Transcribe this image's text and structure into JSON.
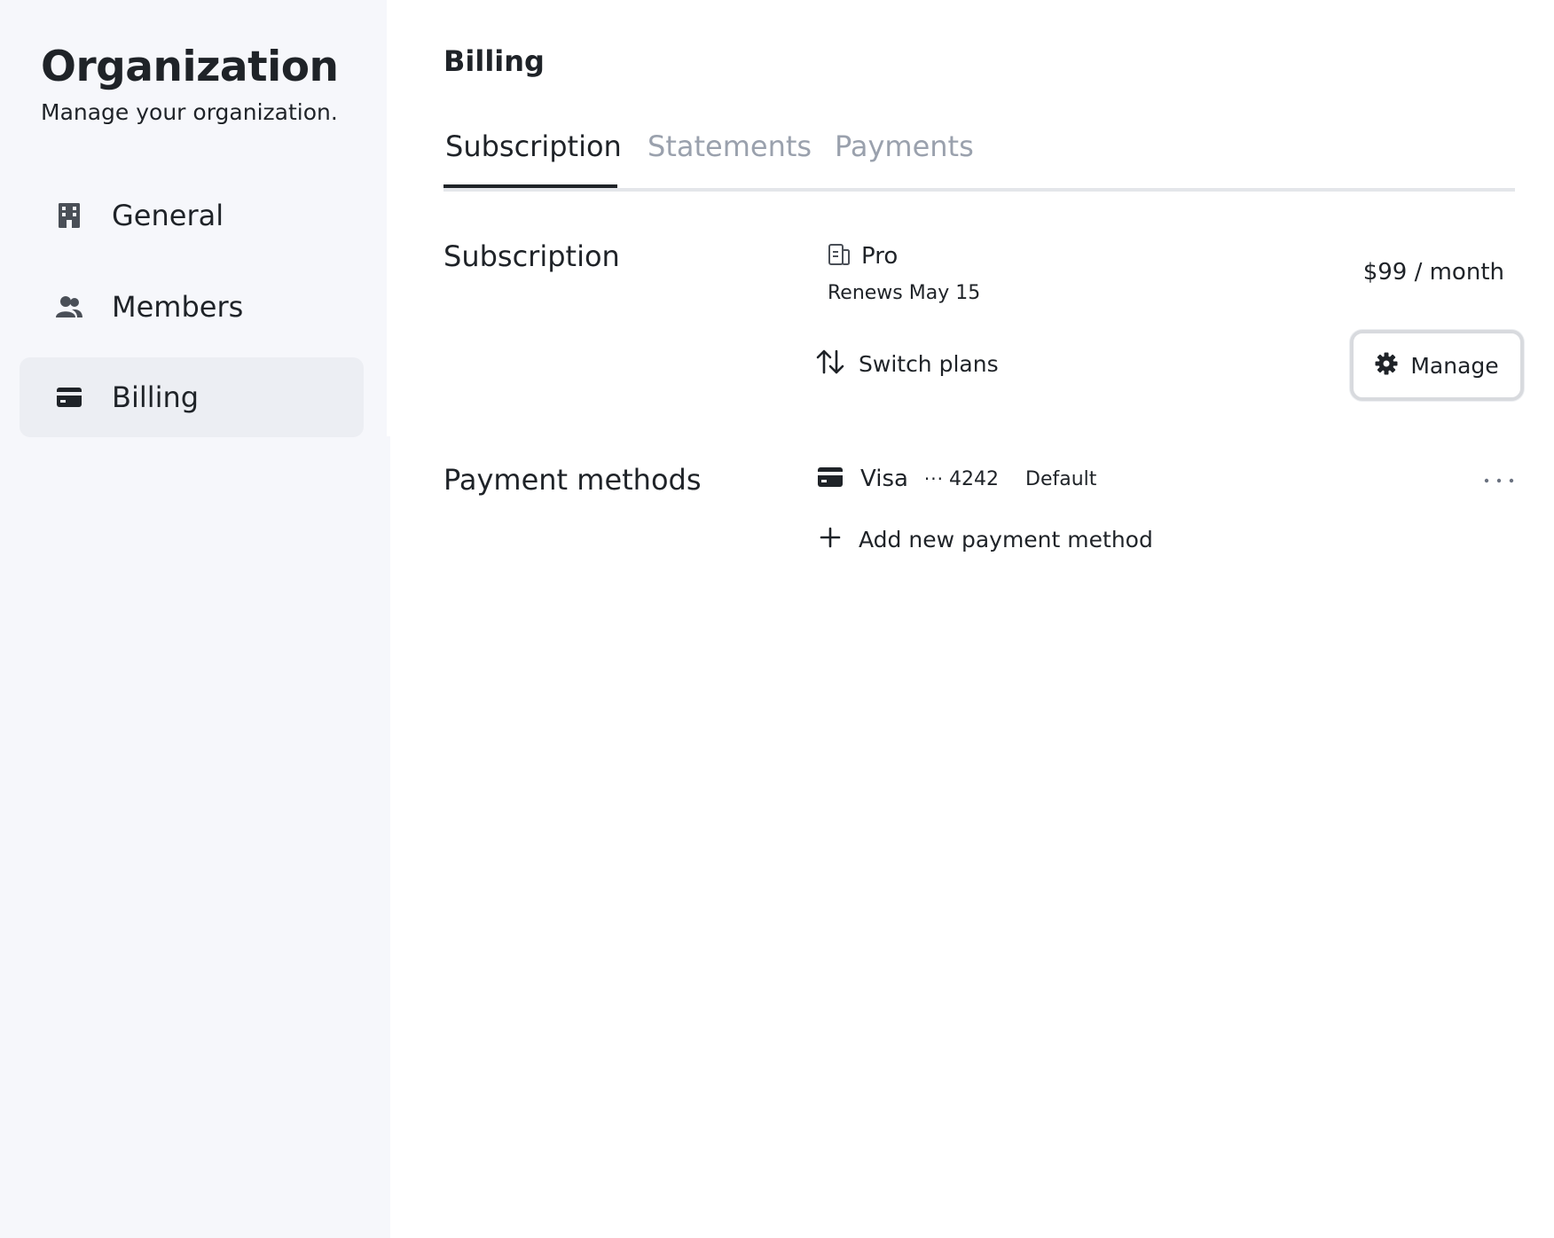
{
  "sidebar": {
    "title": "Organization",
    "subtitle": "Manage your organization.",
    "items": [
      {
        "label": "General",
        "icon": "building-icon",
        "active": false
      },
      {
        "label": "Members",
        "icon": "users-icon",
        "active": false
      },
      {
        "label": "Billing",
        "icon": "credit-card-icon",
        "active": true
      }
    ]
  },
  "main": {
    "title": "Billing",
    "tabs": [
      {
        "label": "Subscription",
        "active": true
      },
      {
        "label": "Statements",
        "active": false
      },
      {
        "label": "Payments",
        "active": false
      }
    ],
    "subscription": {
      "section_label": "Subscription",
      "plan_name": "Pro",
      "renews": "Renews May 15",
      "price": "$99 / month",
      "switch_label": "Switch plans",
      "manage_label": "Manage"
    },
    "payment_methods": {
      "section_label": "Payment methods",
      "brand": "Visa",
      "mask": "···",
      "last4": "4242",
      "default_label": "Default",
      "add_label": "Add new payment method"
    }
  },
  "colors": {
    "text": "#1f2328",
    "muted_tab": "#9aa1ad",
    "sidebar_bg": "#f6f7fb",
    "active_nav_bg": "#eceef3"
  }
}
